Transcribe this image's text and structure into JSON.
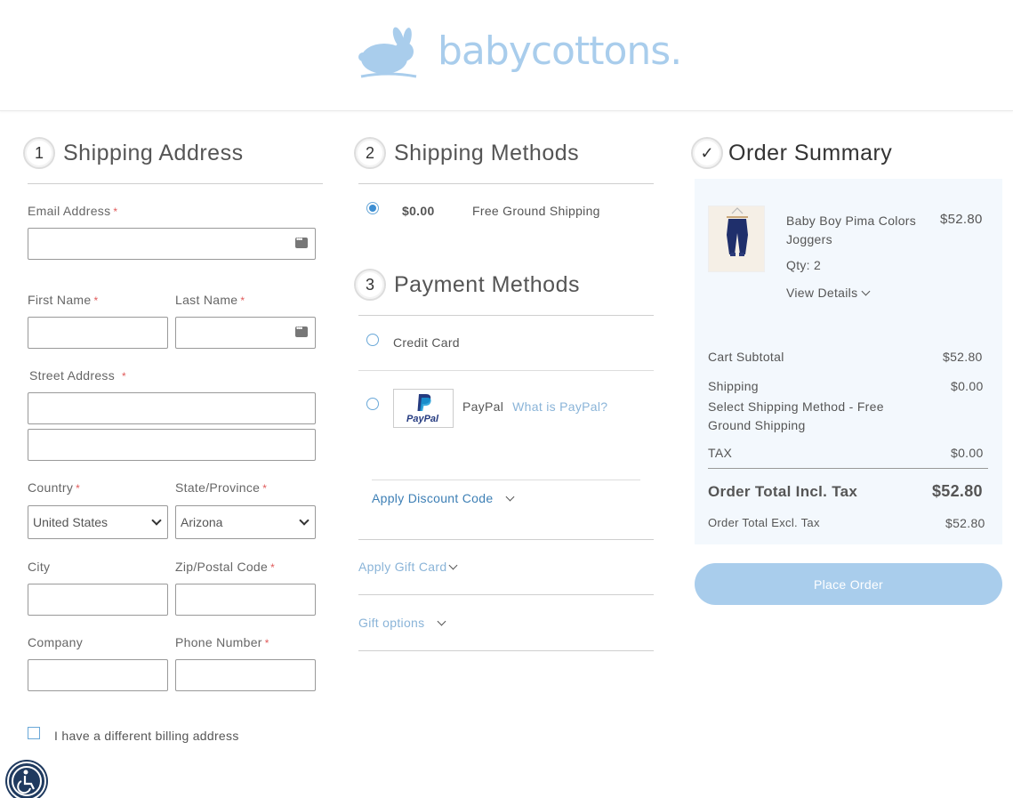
{
  "brand": {
    "name": "babycottons."
  },
  "shipping_address": {
    "step": "1",
    "title": "Shipping Address",
    "email_label": "Email Address",
    "first_name_label": "First Name",
    "last_name_label": "Last Name",
    "street_label": "Street Address",
    "country_label": "Country",
    "country_value": "United States",
    "state_label": "State/Province",
    "state_value": "Arizona",
    "city_label": "City",
    "zip_label": "Zip/Postal Code",
    "company_label": "Company",
    "phone_label": "Phone Number",
    "required_mark": "*",
    "billing_checkbox_label": "I have a different billing address"
  },
  "shipping_methods": {
    "step": "2",
    "title": "Shipping Methods",
    "option_price": "$0.00",
    "option_label": "Free Ground Shipping"
  },
  "payment_methods": {
    "step": "3",
    "title": "Payment Methods",
    "credit_card_label": "Credit Card",
    "paypal_label": "PayPal",
    "paypal_logo_text": "PayPal",
    "what_is_paypal": "What is PayPal?",
    "apply_discount": "Apply Discount Code",
    "apply_gift_card": "Apply Gift Card",
    "gift_options": "Gift options"
  },
  "order_summary": {
    "step": "✓",
    "title": "Order Summary",
    "product_name": "Baby Boy Pima Colors Joggers",
    "product_price": "$52.80",
    "qty_label": "Qty: 2",
    "view_details": "View Details",
    "cart_subtotal_label": "Cart Subtotal",
    "cart_subtotal_value": "$52.80",
    "shipping_label": "Shipping",
    "shipping_value": "$0.00",
    "shipping_method_text": "Select Shipping Method - Free Ground Shipping",
    "tax_label": "TAX",
    "tax_value": "$0.00",
    "total_incl_label": "Order Total Incl. Tax",
    "total_incl_value": "$52.80",
    "total_excl_label": "Order Total Excl. Tax",
    "total_excl_value": "$52.80",
    "place_order": "Place Order"
  },
  "colors": {
    "brand": "#a9cdec",
    "accent": "#3d8ed2",
    "required": "#e05a5a"
  }
}
